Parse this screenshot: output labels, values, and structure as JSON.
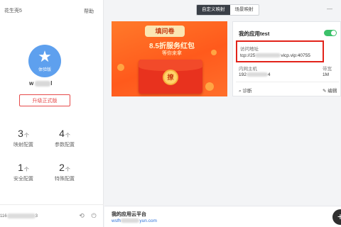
{
  "sidebar": {
    "app_title": "花生壳5",
    "help": "帮助",
    "avatar_label": "体验版",
    "username_prefix": "w",
    "username_suffix": "l",
    "upgrade_button": "升级正式版",
    "stats": [
      {
        "value": "3",
        "unit": "个",
        "label": "映射配置"
      },
      {
        "value": "4",
        "unit": "个",
        "label": "参数配置"
      },
      {
        "value": "1",
        "unit": "个",
        "label": "安全配置"
      },
      {
        "value": "2",
        "unit": "个",
        "label": "特殊配置"
      }
    ],
    "footer_prefix": "116",
    "footer_suffix": "3"
  },
  "header": {
    "tabs": [
      {
        "label": "自定义映射",
        "active": true
      },
      {
        "label": "场景映射",
        "active": false
      }
    ]
  },
  "banner": {
    "badge": "填问卷",
    "line1": "8.5折服务红包",
    "line2": "等你来拿",
    "coin": "撩"
  },
  "app_card": {
    "title": "我的应用test",
    "toggle_on": true,
    "address_label": "访问地址",
    "address_prefix": "tcp://25",
    "address_suffix": "vicp.vip:40755",
    "host_label": "内网主机",
    "host_prefix": "192",
    "host_suffix": "4",
    "bandwidth_label": "带宽",
    "bandwidth_value": "1M",
    "diagnose_label": "诊断",
    "edit_label": "编辑"
  },
  "bottom_bar": {
    "title": "我的应用云平台",
    "link_prefix": "wsfh",
    "link_suffix": "yun.com"
  },
  "colors": {
    "accent_red": "#e64a4a",
    "avatar_blue": "#5ea0ee",
    "toggle_green": "#3cc16a",
    "link_blue": "#2b6fd6"
  }
}
